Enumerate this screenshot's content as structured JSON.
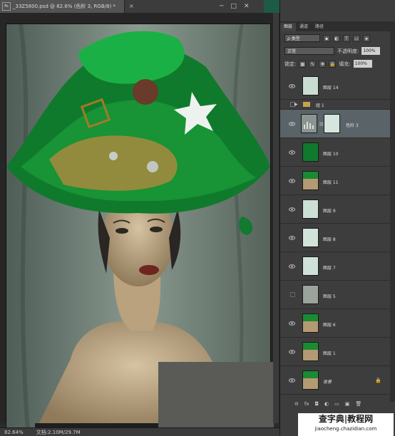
{
  "document": {
    "ps_badge": "Ps",
    "tab_title": "_33Z5800.psd @ 82.6% (色阶 3, RGB/8) *",
    "close": "×",
    "window_buttons": [
      "─",
      "□",
      "✕"
    ]
  },
  "status": {
    "zoom": "82.64%",
    "doc_size": "文档:2.10M/29.7M"
  },
  "panel": {
    "tabs": [
      "图层",
      "通道",
      "路径"
    ],
    "kind_label": "ρ 类型",
    "filter_icons": [
      "image-filter-icon",
      "adjustment-filter-icon",
      "type-filter-icon",
      "shape-filter-icon",
      "smart-object-filter-icon"
    ],
    "blend_mode": "正常",
    "opacity_label": "不透明度:",
    "opacity_value": "100%",
    "lock_label": "锁定:",
    "fill_label": "填充:",
    "fill_value": "100%",
    "layers": [
      {
        "name": "图层 14",
        "thumb": "#c9ddd3",
        "visible": true
      },
      {
        "name": "组 1",
        "type": "group",
        "visible": false
      },
      {
        "name": "色阶 3",
        "type": "adjustment",
        "thumb": "#d4e6dd",
        "visible": true,
        "selected": true
      },
      {
        "name": "图层 10",
        "thumb": "#0f7a2c",
        "visible": true
      },
      {
        "name": "图层 11",
        "thumb": "photo",
        "visible": true
      },
      {
        "name": "图层 9",
        "thumb": "#cde0d6",
        "visible": true
      },
      {
        "name": "图层 8",
        "thumb": "#d2e4da",
        "visible": true
      },
      {
        "name": "图层 7",
        "thumb": "#cfe1d8",
        "visible": true
      },
      {
        "name": "图层 5",
        "thumb": "#9aa39c",
        "visible": false
      },
      {
        "name": "图层 6",
        "thumb": "photo",
        "visible": true
      },
      {
        "name": "图层 1",
        "thumb": "photo",
        "visible": true
      },
      {
        "name": "背景",
        "thumb": "photo",
        "visible": true,
        "locked": true
      }
    ],
    "footer_icons": [
      "link-icon",
      "fx-icon",
      "mask-icon",
      "adjustment-icon",
      "folder-icon",
      "new-layer-icon",
      "trash-icon"
    ],
    "footer_glyphs": [
      "⊖",
      "fx",
      "◘",
      "◐",
      "▭",
      "▣",
      "🗑"
    ]
  },
  "watermark": {
    "line1": "查字典|教程网",
    "line2": "jiaocheng.chazidian.com"
  },
  "colors": {
    "accent_green": "#1a8a33",
    "panel_bg": "#3d3d3d",
    "selected_row": "#5a6468"
  }
}
